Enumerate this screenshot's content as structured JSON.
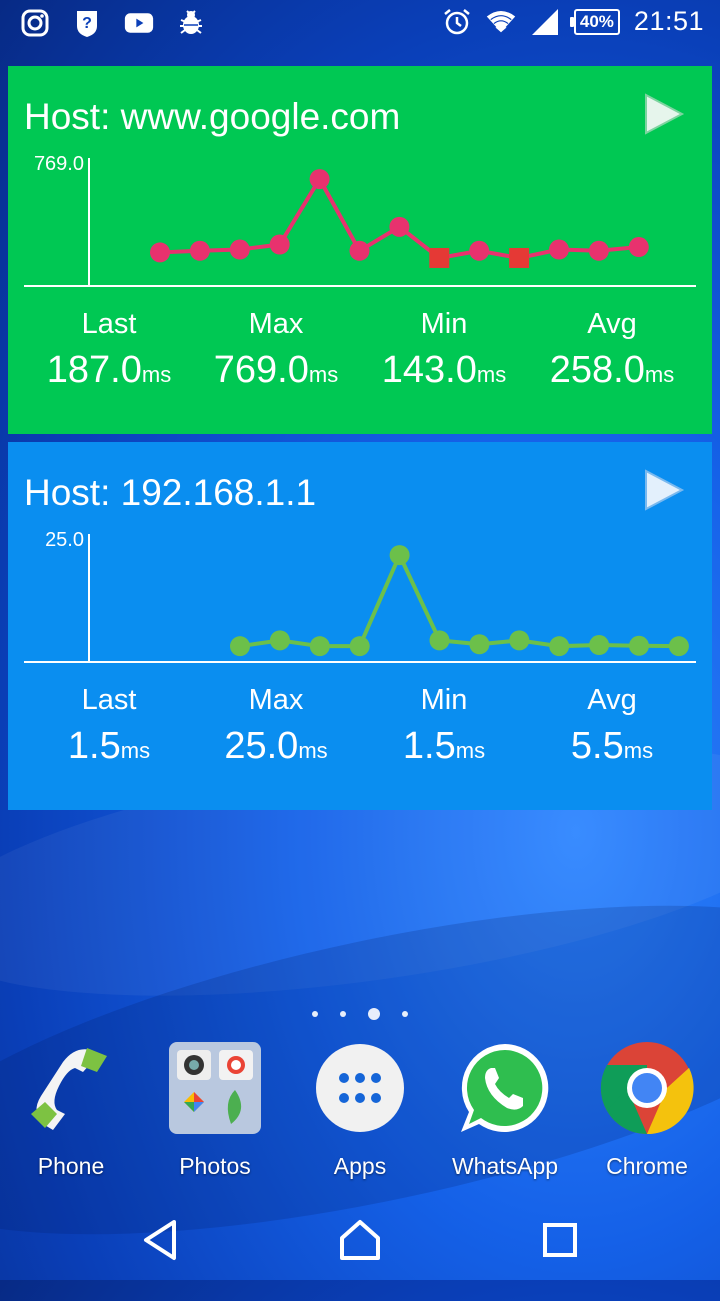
{
  "status_bar": {
    "left_icons": [
      "instagram-icon",
      "unknown-notification-icon",
      "youtube-icon",
      "bug-icon"
    ],
    "battery": "40%",
    "time": "21:51"
  },
  "widgets": [
    {
      "host_label": "Host:",
      "host": "www.google.com",
      "y_max_label": "769.0",
      "stats": {
        "last_label": "Last",
        "last": "187.0",
        "last_unit": "ms",
        "max_label": "Max",
        "max": "769.0",
        "max_unit": "ms",
        "min_label": "Min",
        "min": "143.0",
        "min_unit": "ms",
        "avg_label": "Avg",
        "avg": "258.0",
        "avg_unit": "ms"
      }
    },
    {
      "host_label": "Host:",
      "host": "192.168.1.1",
      "y_max_label": "25.0",
      "stats": {
        "last_label": "Last",
        "last": "1.5",
        "last_unit": "ms",
        "max_label": "Max",
        "max": "25.0",
        "max_unit": "ms",
        "min_label": "Min",
        "min": "1.5",
        "min_unit": "ms",
        "avg_label": "Avg",
        "avg": "5.5",
        "avg_unit": "ms"
      }
    }
  ],
  "chart_data": [
    {
      "type": "line",
      "x": [
        1,
        2,
        3,
        4,
        5,
        6,
        7,
        8,
        9,
        10,
        11,
        12,
        13
      ],
      "series": [
        {
          "values": [
            187,
            200,
            210,
            250,
            769,
            200,
            390,
            143,
            200,
            143,
            210,
            200,
            230
          ]
        }
      ],
      "ylim": [
        0,
        769
      ],
      "y_tick_labels": [
        "769.0"
      ],
      "color": "#e8326e",
      "marker_shape": "circle",
      "failed_marker_color": "#e53935",
      "failed_indices": [
        7,
        9
      ]
    },
    {
      "type": "line",
      "x": [
        1,
        2,
        3,
        4,
        5,
        6,
        7,
        8,
        9,
        10,
        11,
        12
      ],
      "series": [
        {
          "values": [
            1.5,
            3.0,
            1.5,
            1.5,
            25.0,
            3.0,
            2.0,
            3.0,
            1.5,
            1.8,
            1.6,
            1.5
          ]
        }
      ],
      "ylim": [
        0,
        25
      ],
      "y_tick_labels": [
        "25.0"
      ],
      "color": "#6cc04a",
      "marker_shape": "circle"
    }
  ],
  "dock": [
    {
      "label": "Phone",
      "icon": "phone-icon"
    },
    {
      "label": "Photos",
      "icon": "photos-folder-icon"
    },
    {
      "label": "Apps",
      "icon": "apps-grid-icon"
    },
    {
      "label": "WhatsApp",
      "icon": "whatsapp-icon"
    },
    {
      "label": "Chrome",
      "icon": "chrome-icon"
    }
  ],
  "page_indicator": {
    "count": 4,
    "active": 2
  },
  "nav": [
    "back-icon",
    "home-icon",
    "recents-icon"
  ]
}
